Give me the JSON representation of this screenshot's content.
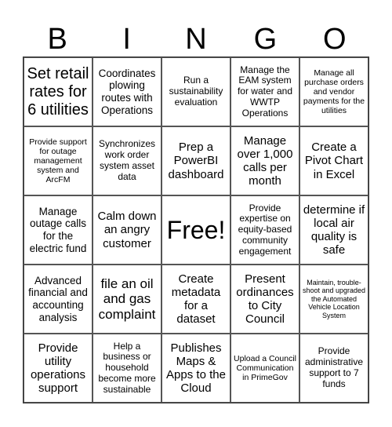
{
  "header": {
    "letters": [
      "B",
      "I",
      "N",
      "G",
      "O"
    ]
  },
  "board": {
    "cells": [
      "Set retail rates for 6 utilities",
      "Coordinates plowing routes with Operations",
      "Run a sustainability evaluation",
      "Manage the EAM system for water and WWTP Operations",
      "Manage all purchase orders and vendor payments for the utilities",
      "Provide support for outage management system and ArcFM",
      "Synchronizes work order system asset data",
      "Prep a PowerBI dashboard",
      "Manage over 1,000 calls per month",
      "Create a Pivot Chart in Excel",
      "Manage outage calls for the electric fund",
      "Calm down an angry customer",
      "Free!",
      "Provide expertise on equity-based community engagement",
      "determine if local air quality is safe",
      "Advanced financial and accounting analysis",
      "file an oil and gas complaint",
      "Create metadata for a dataset",
      "Present ordinances to City Council",
      "Maintain, trouble-shoot and upgraded the Automated Vehicle Location System",
      "Provide utility operations support",
      "Help a business or household become more sustainable",
      "Publishes Maps & Apps to the Cloud",
      "Upload a Council Communication in PrimeGov",
      "Provide administrative support to 7 funds"
    ]
  }
}
